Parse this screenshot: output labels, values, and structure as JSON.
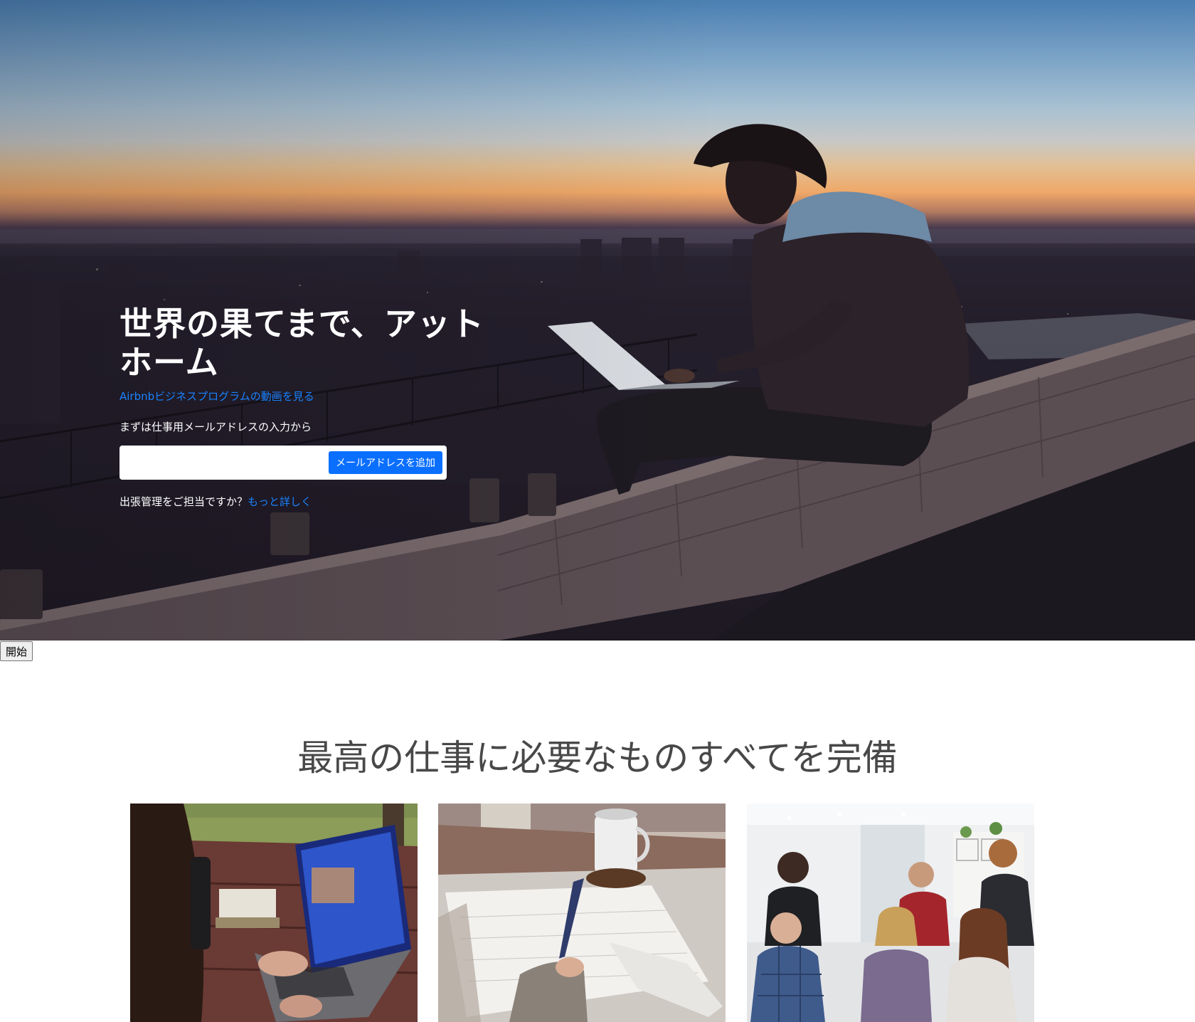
{
  "hero": {
    "title": "世界の果てまで、アットホーム",
    "video_link": "Airbnbビジネスプログラムの動画を見る",
    "prompt": "まずは仕事用メールアドレスの入力から",
    "email_placeholder": "",
    "add_email_button": "メールアドレスを追加",
    "travel_question": "出張管理をご担当ですか？",
    "travel_link": "もっと詳しく"
  },
  "start_button": "開始",
  "features": {
    "heading": "最高の仕事に必要なものすべてを完備",
    "cards": [
      {
        "image": "woman-working-on-laptop-outdoors"
      },
      {
        "image": "hand-writing-on-notebook-with-coffee"
      },
      {
        "image": "team-meeting-in-office"
      }
    ]
  },
  "colors": {
    "link_blue": "#1a82ff",
    "button_blue": "#0a6fff",
    "heading_gray": "#484848"
  }
}
